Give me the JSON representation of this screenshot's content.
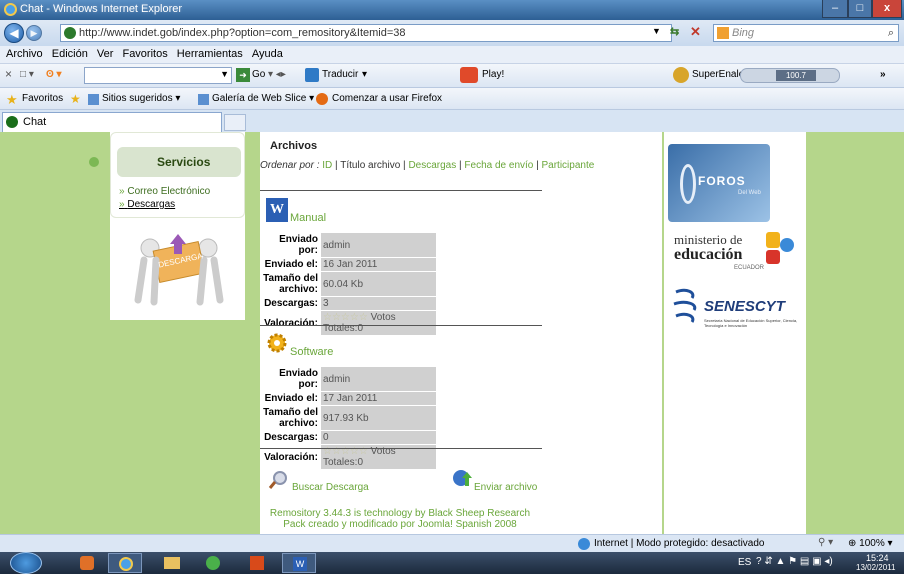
{
  "window": {
    "title": "Chat - Windows Internet Explorer",
    "minimize": "–",
    "maximize": "□",
    "close": "x"
  },
  "address_bar": {
    "url": "http://www.indet.gob/index.php?option=com_remository&Itemid=38",
    "search_placeholder": "Bing"
  },
  "menu": [
    "Archivo",
    "Edición",
    "Ver",
    "Favoritos",
    "Herramientas",
    "Ayuda"
  ],
  "toolbar": {
    "go_label": "Go",
    "translate_label": "Traducir",
    "play_label": "Play!",
    "superenalotto_label": "SuperEnalotto",
    "counter": "100.7"
  },
  "favorites_bar": {
    "favorites_label": "Favoritos",
    "items": [
      "Sitios sugeridos",
      "Galería de Web Slice",
      "Comenzar a usar Firefox"
    ]
  },
  "tab": {
    "label": "Chat"
  },
  "left_module": {
    "title": "Servicios",
    "links": [
      "Correo Electrónico",
      "Descargas"
    ],
    "banner_text": "DESCARGA"
  },
  "content": {
    "heading": "Archivos",
    "ordenar_label": "Ordenar por :",
    "ordenar_options": [
      "ID",
      "Título archivo",
      "Descargas",
      "Fecha de envío",
      "Participante"
    ],
    "files": [
      {
        "name": "Manual",
        "enviado_por_label": "Enviado por:",
        "enviado_por": "admin",
        "enviado_el_label": "Enviado el:",
        "enviado_el": "16 Jan 2011",
        "tamano_label": "Tamaño del archivo:",
        "tamano": "60.04 Kb",
        "descargas_label": "Descargas:",
        "descargas": "3",
        "valoracion_label": "Valoración:",
        "votos": "Votos Totales:0"
      },
      {
        "name": "Software",
        "enviado_por_label": "Enviado por:",
        "enviado_por": "admin",
        "enviado_el_label": "Enviado el:",
        "enviado_el": "17 Jan 2011",
        "tamano_label": "Tamaño del archivo:",
        "tamano": "917.93 Kb",
        "descargas_label": "Descargas:",
        "descargas": "0",
        "valoracion_label": "Valoración:",
        "votos": "Votos Totales:0"
      }
    ],
    "buscar_label": "Buscar Descarga",
    "enviar_label": "Enviar archivo",
    "footer_line1": "Remository 3.44.3 is technology by Black Sheep Research",
    "footer_line2": "Pack creado y modificado por Joomla! Spanish 2008"
  },
  "right_banners": {
    "foros": "FOROS",
    "foros_sub": "Del Web",
    "ministerio_line1": "ministerio de",
    "ministerio_line2": "educación",
    "ministerio_line3": "ECUADOR",
    "senescyt": "SENESCYT",
    "senescyt_sub": "Secretaría Nacional de Educación Superior, Ciencia, Tecnología e Innovación"
  },
  "status_bar": {
    "zone_text": "Internet | Modo protegido: desactivado",
    "zoom": "100%"
  },
  "taskbar": {
    "lang": "ES",
    "time": "15:24",
    "date": "13/02/2011"
  },
  "colors": {
    "page_bg": "#b5d68b",
    "link_green": "#6aa63a",
    "title_bar": "#2d5f94"
  }
}
